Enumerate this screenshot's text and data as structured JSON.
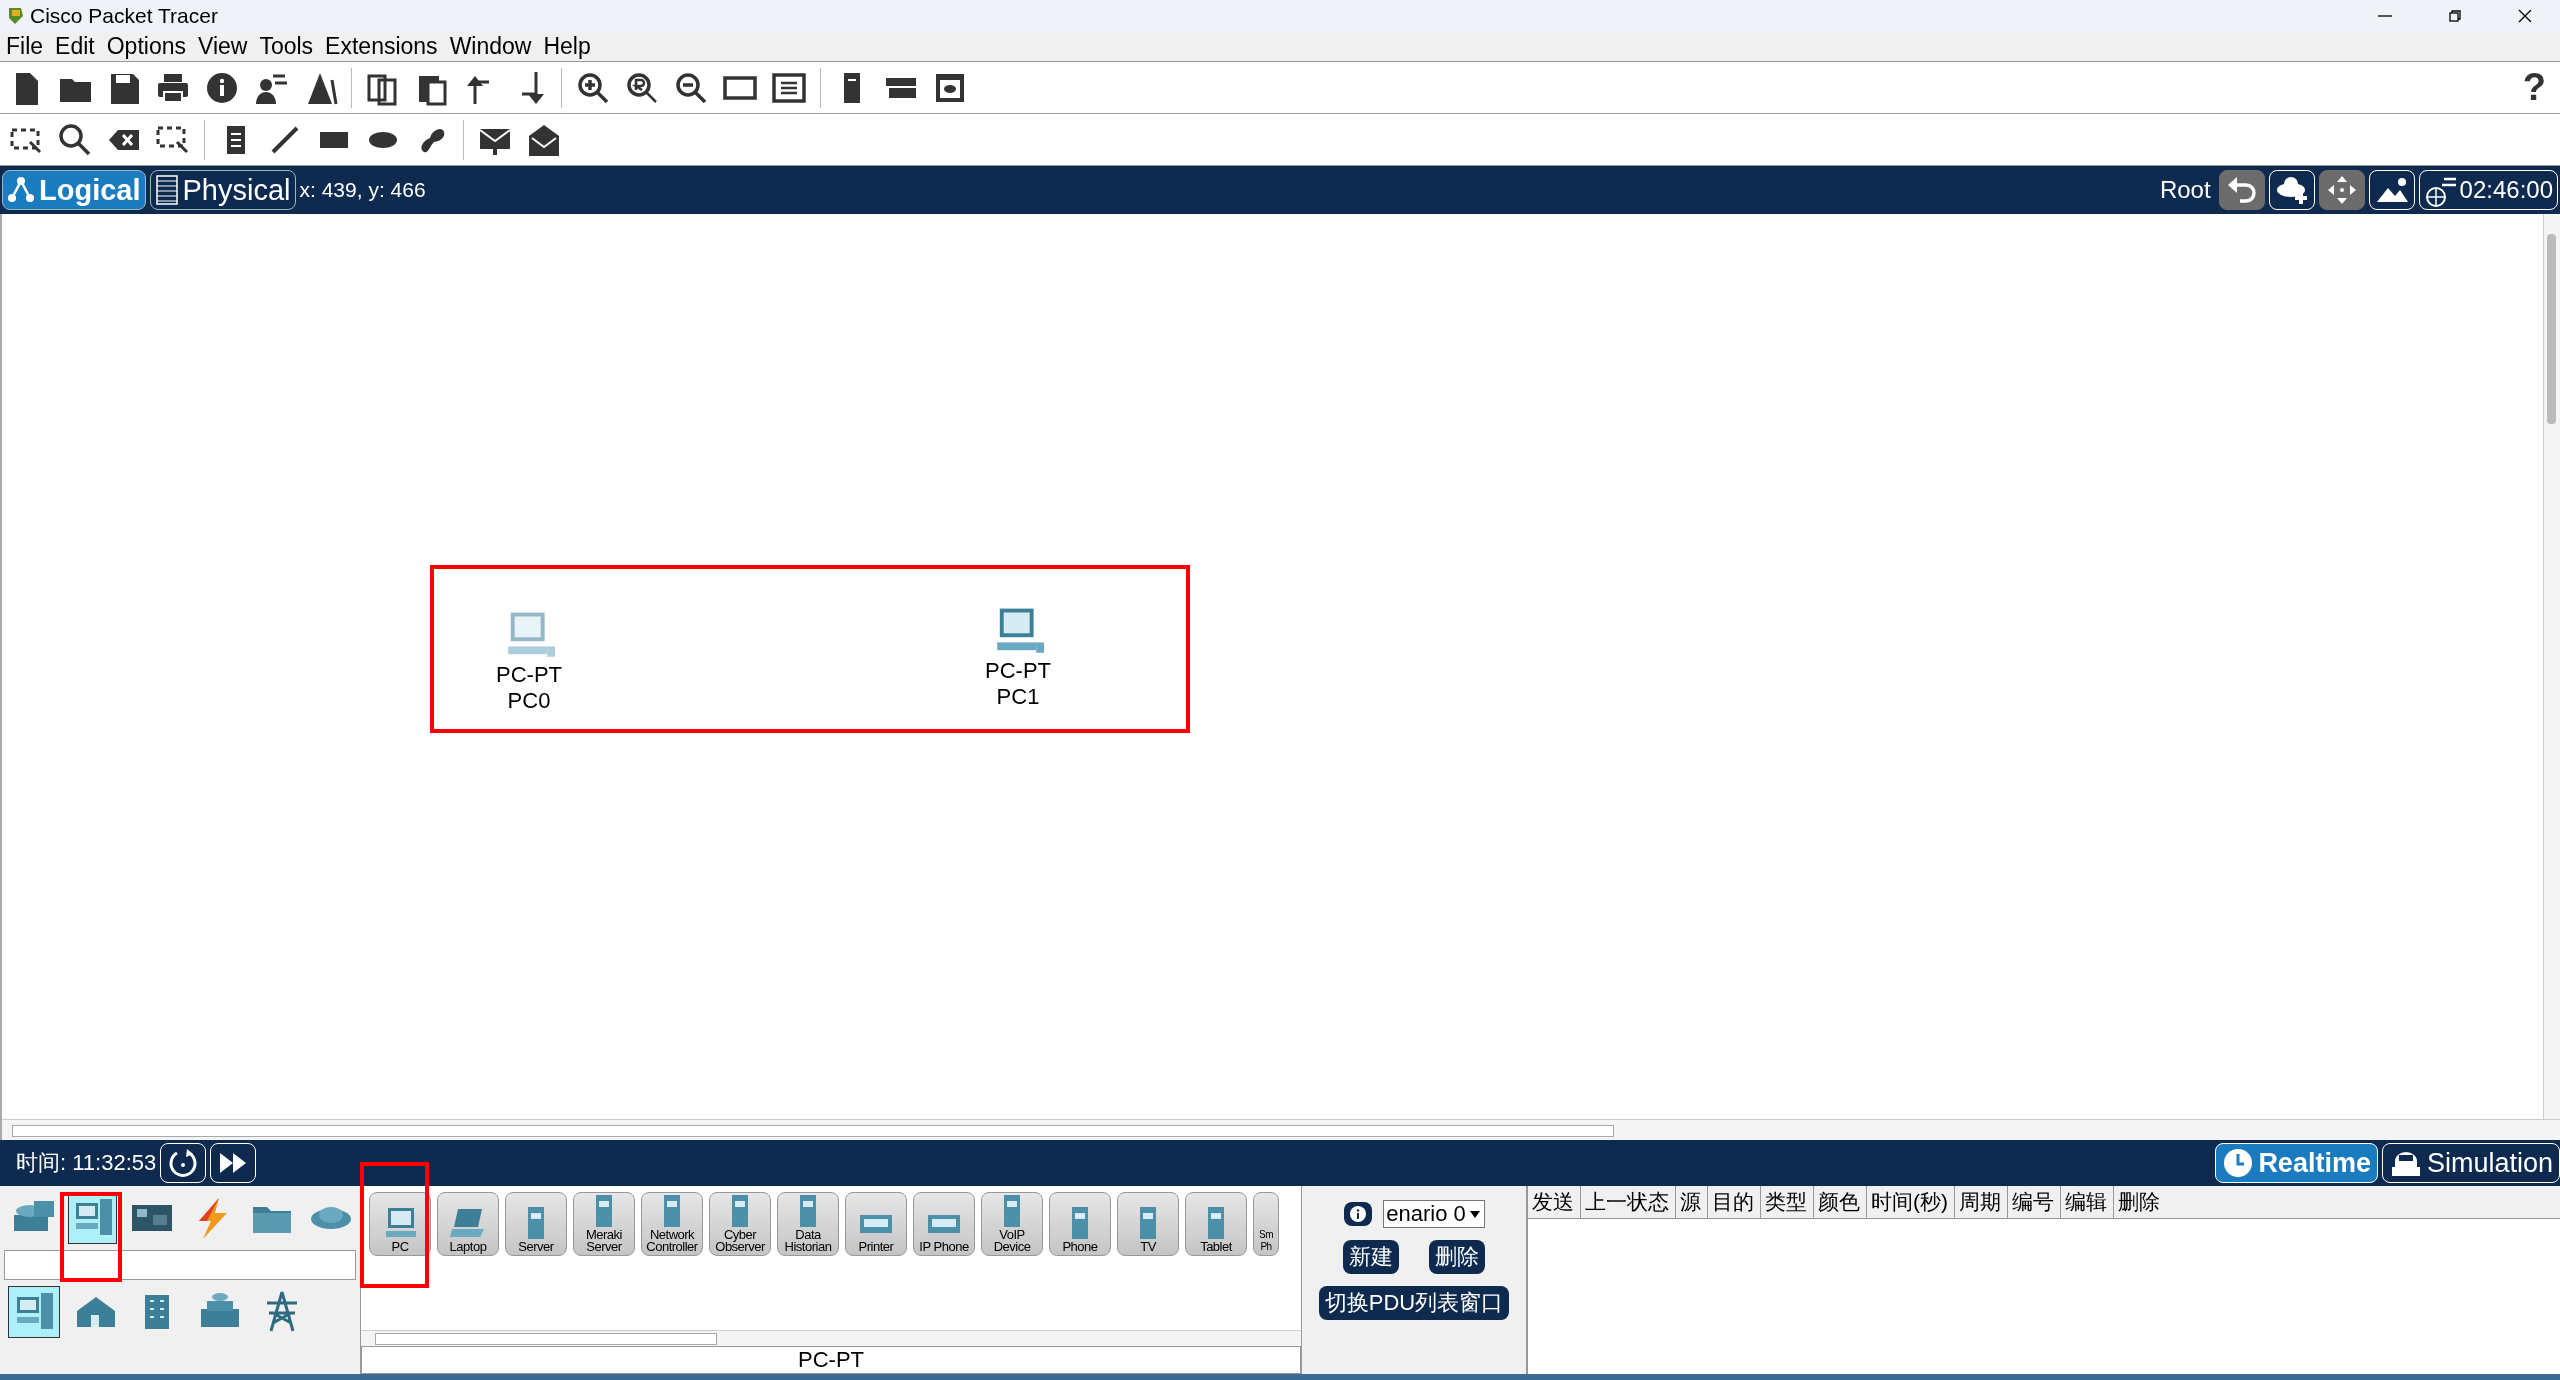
{
  "window": {
    "title": "Cisco Packet Tracer"
  },
  "menu": [
    "File",
    "Edit",
    "Options",
    "View",
    "Tools",
    "Extensions",
    "Window",
    "Help"
  ],
  "help_glyph": "?",
  "workspace_tabs": [
    {
      "label": "Logical",
      "selected": true
    },
    {
      "label": "Physical",
      "selected": false
    }
  ],
  "coordinates": "x: 439, y: 466",
  "root_label": "Root",
  "clock": "02:46:00",
  "canvas": {
    "devices": [
      {
        "model": "PC-PT",
        "name": "PC0",
        "dimmed": true
      },
      {
        "model": "PC-PT",
        "name": "PC1",
        "dimmed": false
      }
    ]
  },
  "time_label": "时间: 11:32:53",
  "modes": [
    {
      "label": "Realtime",
      "selected": true
    },
    {
      "label": "Simulation",
      "selected": false
    }
  ],
  "device_categories": [
    {
      "selected": false
    },
    {
      "selected": true
    },
    {
      "selected": false
    },
    {
      "selected": false
    },
    {
      "selected": false
    },
    {
      "selected": false
    }
  ],
  "device_subcategories": [
    {
      "selected": true
    },
    {
      "selected": false
    },
    {
      "selected": false
    },
    {
      "selected": false
    },
    {
      "selected": false
    }
  ],
  "devices": [
    {
      "label": "PC"
    },
    {
      "label": "Laptop"
    },
    {
      "label": "Server"
    },
    {
      "label": "Meraki Server"
    },
    {
      "label": "Network Controller"
    },
    {
      "label": "Cyber Observer"
    },
    {
      "label": "Data Historian"
    },
    {
      "label": "Printer"
    },
    {
      "label": "IP Phone"
    },
    {
      "label": "VoIP Device"
    },
    {
      "label": "Phone"
    },
    {
      "label": "TV"
    },
    {
      "label": "Tablet"
    },
    {
      "label": "Sm Ph"
    }
  ],
  "device_model": "PC-PT",
  "scenario": {
    "value": "enario 0",
    "buttons": [
      "新建",
      "删除"
    ],
    "toggle": "切换PDU列表窗口"
  },
  "pdu_table": {
    "columns": [
      "发送",
      "上一状态",
      "源",
      "目的",
      "类型",
      "颜色",
      "时间(秒)",
      "周期",
      "编号",
      "编辑",
      "删除"
    ]
  }
}
